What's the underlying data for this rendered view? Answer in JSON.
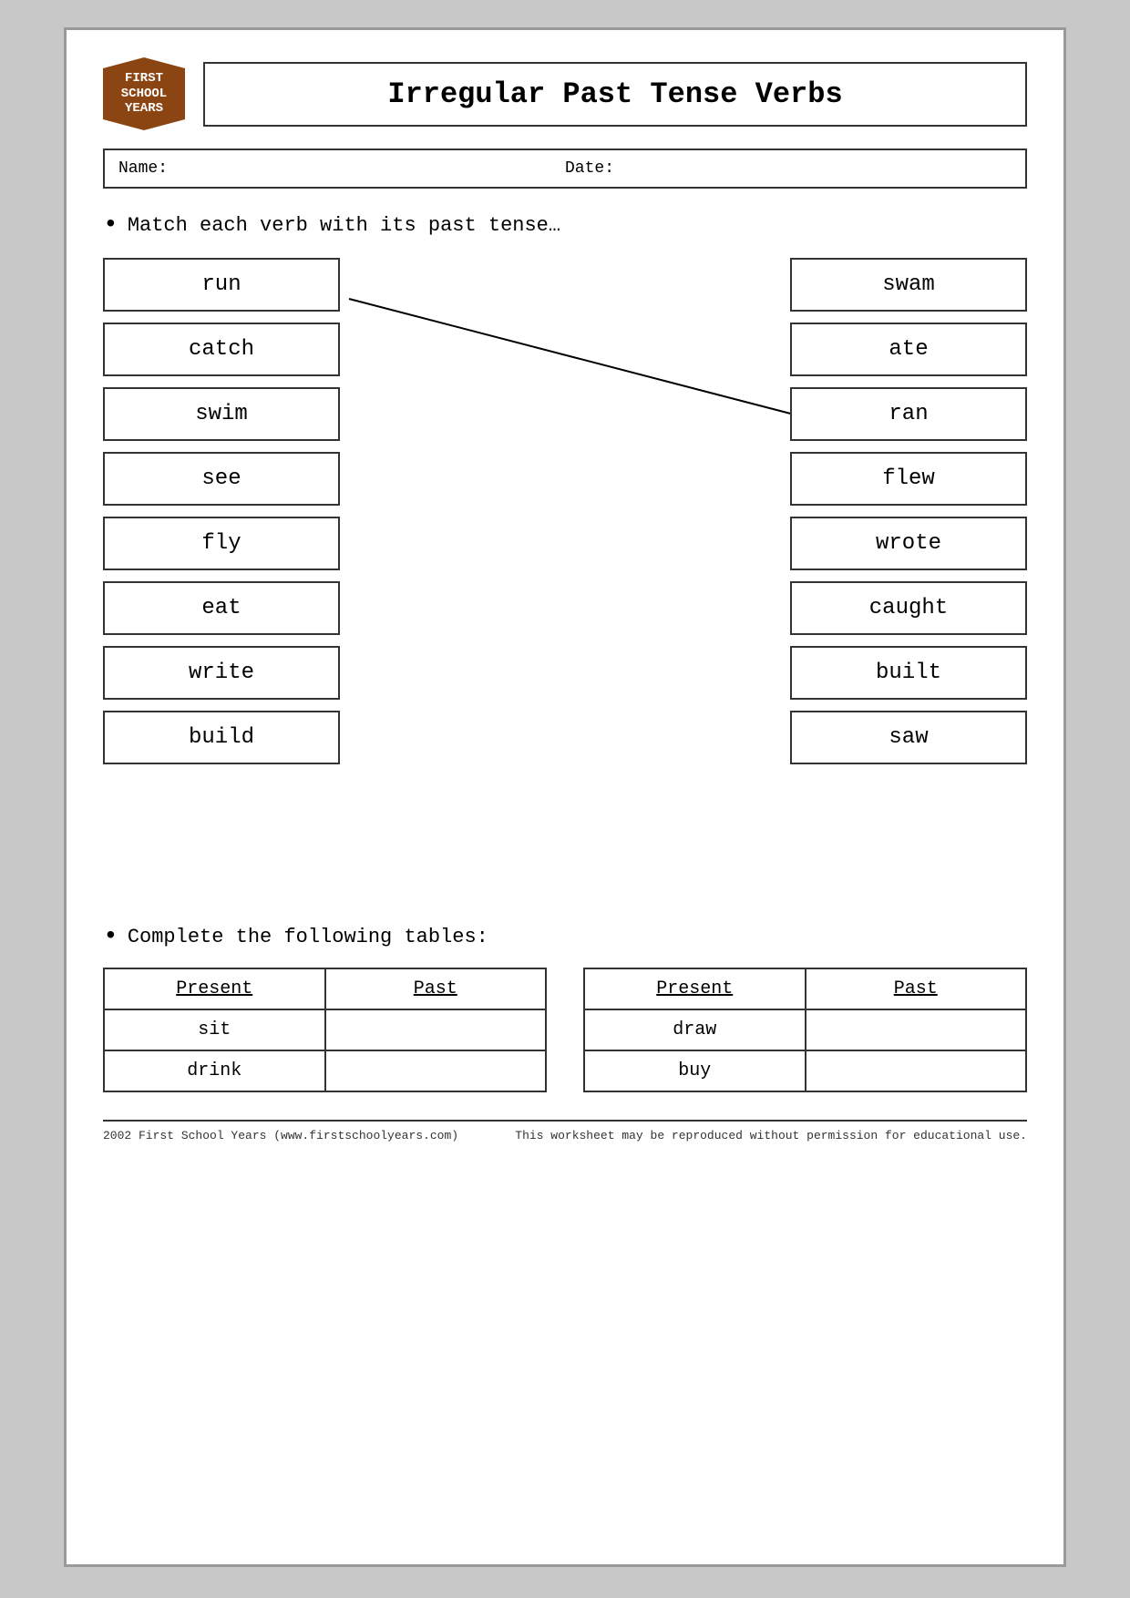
{
  "logo": {
    "line1": "FIRST",
    "line2": "SCHOOL",
    "line3": "YEARS"
  },
  "title": "Irregular Past Tense Verbs",
  "name_label": "Name:",
  "date_label": "Date:",
  "instruction1": "Match each verb with its past tense…",
  "instruction2": "Complete the following tables:",
  "left_verbs": [
    {
      "id": "run",
      "label": "run"
    },
    {
      "id": "catch",
      "label": "catch"
    },
    {
      "id": "swim",
      "label": "swim"
    },
    {
      "id": "see",
      "label": "see"
    },
    {
      "id": "fly",
      "label": "fly"
    },
    {
      "id": "eat",
      "label": "eat"
    },
    {
      "id": "write",
      "label": "write"
    },
    {
      "id": "build",
      "label": "build"
    }
  ],
  "right_verbs": [
    {
      "id": "swam",
      "label": "swam"
    },
    {
      "id": "ate",
      "label": "ate"
    },
    {
      "id": "ran",
      "label": "ran"
    },
    {
      "id": "flew",
      "label": "flew"
    },
    {
      "id": "wrote",
      "label": "wrote"
    },
    {
      "id": "caught",
      "label": "caught"
    },
    {
      "id": "built",
      "label": "built"
    },
    {
      "id": "saw",
      "label": "saw"
    }
  ],
  "table1": {
    "col1": "Present",
    "col2": "Past",
    "rows": [
      {
        "present": "sit",
        "past": ""
      },
      {
        "present": "drink",
        "past": ""
      }
    ]
  },
  "table2": {
    "col1": "Present",
    "col2": "Past",
    "rows": [
      {
        "present": "draw",
        "past": ""
      },
      {
        "present": "buy",
        "past": ""
      }
    ]
  },
  "footer_left": "2002 First School Years  (www.firstschoolyears.com)",
  "footer_right": "This worksheet may be reproduced without permission for educational use."
}
